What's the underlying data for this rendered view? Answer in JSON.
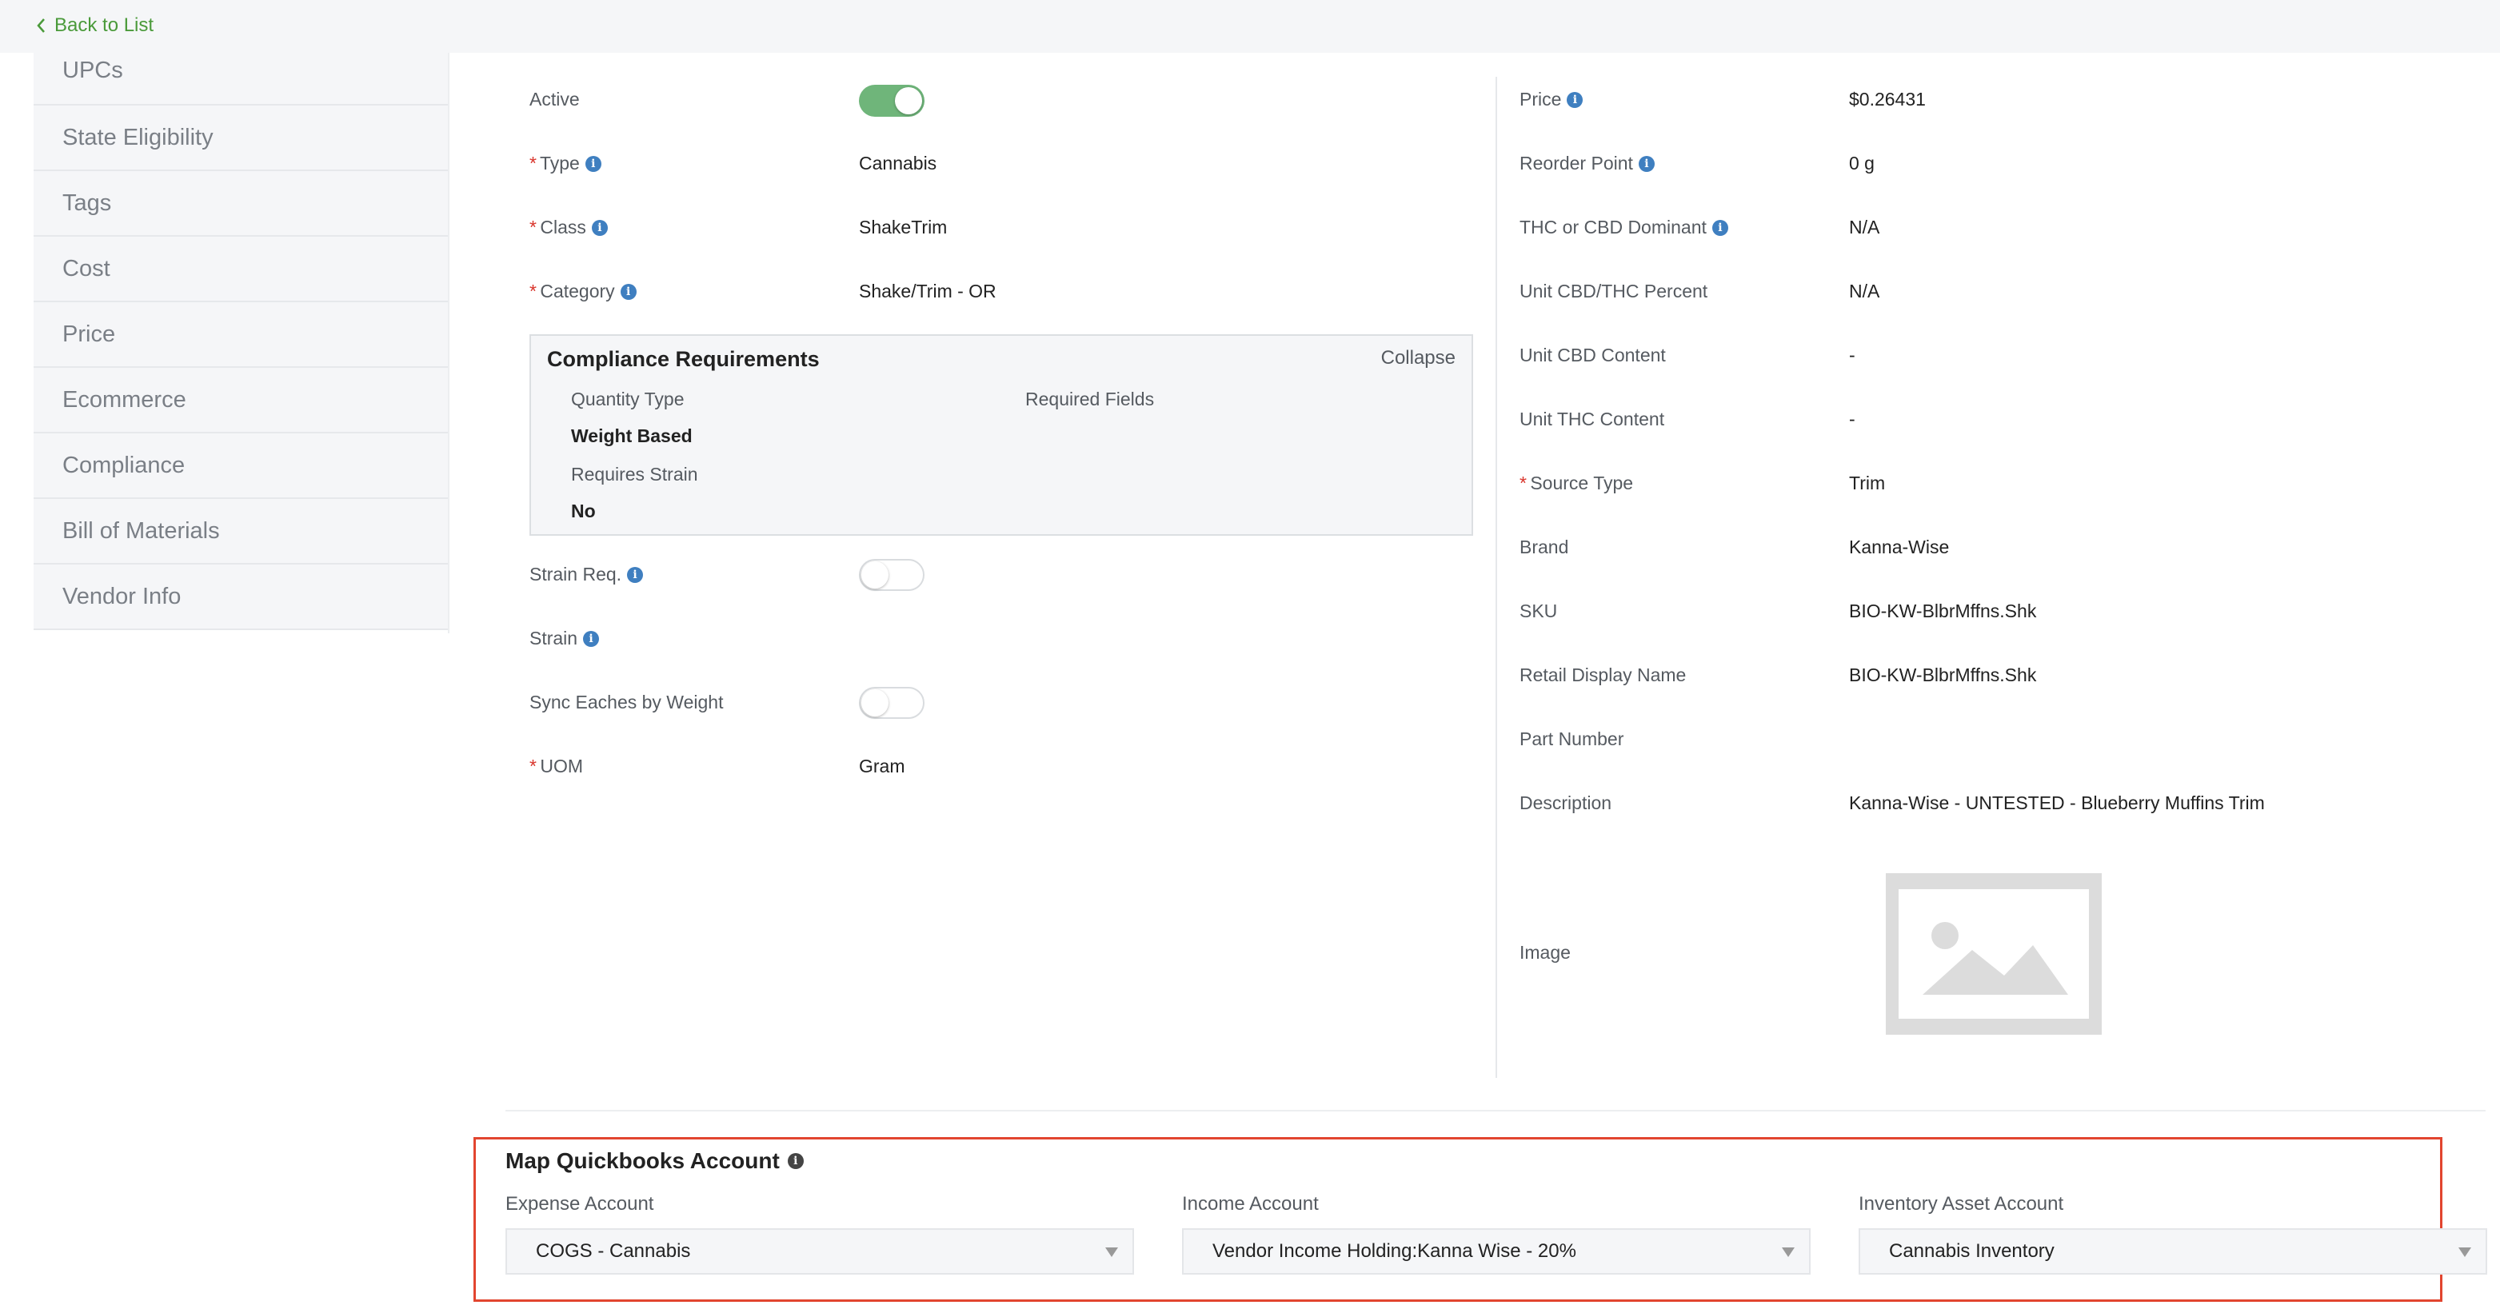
{
  "nav": {
    "back_label": "Back to List"
  },
  "sidebar": {
    "items": [
      {
        "label": "UPCs"
      },
      {
        "label": "State Eligibility"
      },
      {
        "label": "Tags"
      },
      {
        "label": "Cost"
      },
      {
        "label": "Price"
      },
      {
        "label": "Ecommerce"
      },
      {
        "label": "Compliance"
      },
      {
        "label": "Bill of Materials"
      },
      {
        "label": "Vendor Info"
      }
    ]
  },
  "left_fields": {
    "active": {
      "label": "Active",
      "toggle_state": "on"
    },
    "type": {
      "label": "Type",
      "value": "Cannabis"
    },
    "class": {
      "label": "Class",
      "value": "ShakeTrim"
    },
    "category": {
      "label": "Category",
      "value": "Shake/Trim - OR"
    },
    "strain_req": {
      "label": "Strain Req.",
      "toggle_state": "off"
    },
    "strain": {
      "label": "Strain",
      "value": ""
    },
    "sync_eaches": {
      "label": "Sync Eaches by Weight",
      "toggle_state": "off"
    },
    "uom": {
      "label": "UOM",
      "value": "Gram"
    }
  },
  "compliance": {
    "title": "Compliance Requirements",
    "collapse_label": "Collapse",
    "quantity_type_label": "Quantity Type",
    "quantity_type_value": "Weight Based",
    "required_fields_label": "Required Fields",
    "requires_strain_label": "Requires Strain",
    "requires_strain_value": "No"
  },
  "right_fields": {
    "price": {
      "label": "Price",
      "value": "$0.26431"
    },
    "reorder_point": {
      "label": "Reorder Point",
      "value": "0 g"
    },
    "dominant": {
      "label": "THC or CBD Dominant",
      "value": "N/A"
    },
    "unit_percent": {
      "label": "Unit CBD/THC Percent",
      "value": "N/A"
    },
    "unit_cbd": {
      "label": "Unit CBD Content",
      "value": "-"
    },
    "unit_thc": {
      "label": "Unit THC Content",
      "value": "-"
    },
    "source_type": {
      "label": "Source Type",
      "value": "Trim"
    },
    "brand": {
      "label": "Brand",
      "value": "Kanna-Wise"
    },
    "sku": {
      "label": "SKU",
      "value": "BIO-KW-BlbrMffns.Shk"
    },
    "retail_name": {
      "label": "Retail Display Name",
      "value": "BIO-KW-BlbrMffns.Shk"
    },
    "part_number": {
      "label": "Part Number",
      "value": ""
    },
    "description": {
      "label": "Description",
      "value": "Kanna-Wise - UNTESTED - Blueberry Muffins Trim"
    },
    "image": {
      "label": "Image",
      "icon": "image-placeholder-icon"
    }
  },
  "quickbooks": {
    "title": "Map Quickbooks Account",
    "expense_label": "Expense Account",
    "expense_value": "COGS - Cannabis",
    "income_label": "Income Account",
    "income_value": "Vendor Income Holding:Kanna Wise - 20%",
    "inventory_label": "Inventory Asset Account",
    "inventory_value": "Cannabis Inventory"
  },
  "colors": {
    "accent_green": "#4a9a3a",
    "toggle_on": "#6fb57a",
    "required_red": "#d9342b",
    "info_blue": "#3f7fc0",
    "highlight_border": "#e2452f"
  }
}
